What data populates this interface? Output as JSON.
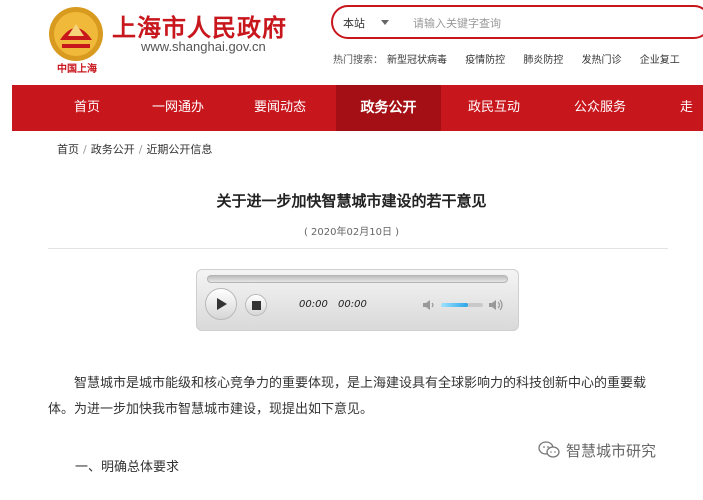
{
  "header": {
    "site_title": "上海市人民政府",
    "site_url": "www.shanghai.gov.cn",
    "emblem_text": "中国上海",
    "search": {
      "scope": "本站",
      "placeholder": "请输入关键字查询"
    },
    "hot": {
      "label": "热门搜索：",
      "items": [
        "新型冠状病毒",
        "疫情防控",
        "肺炎防控",
        "发热门诊",
        "企业复工"
      ]
    }
  },
  "nav": {
    "items": [
      "首页",
      "一网通办",
      "要闻动态",
      "政务公开",
      "政民互动",
      "公众服务",
      "走"
    ],
    "active_index": 3
  },
  "breadcrumb": [
    "首页",
    "政务公开",
    "近期公开信息"
  ],
  "article": {
    "title": "关于进一步加快智慧城市建设的若干意见",
    "date": "( 2020年02月10日 )",
    "paragraph": "智慧城市是城市能级和核心竞争力的重要体现，是上海建设具有全球影响力的科技创新中心的重要载体。为进一步加快我市智慧城市建设，现提出如下意见。",
    "section_heading": "一、明确总体要求"
  },
  "player": {
    "current_time": "00:00",
    "duration": "00:00",
    "volume": 0.65,
    "progress": 0
  },
  "watermark": {
    "text": "智慧城市研究"
  },
  "colors": {
    "brand_red": "#c8161d",
    "nav_active": "#a30f14"
  }
}
